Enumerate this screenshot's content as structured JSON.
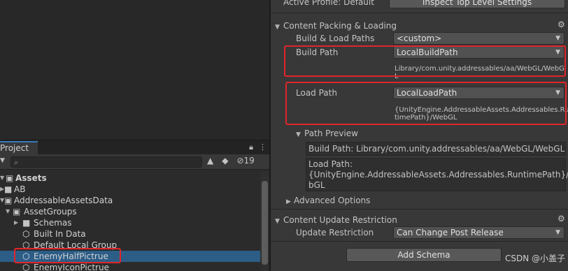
{
  "project": {
    "tab_label": "Project",
    "lock_icon": "lock-icon",
    "menu_icon": "kebab-menu-icon",
    "visible_count": "19",
    "tree": [
      {
        "label": "Assets",
        "icon": "folder-open-icon",
        "bold": true
      },
      {
        "label": "AB",
        "icon": "folder-icon"
      },
      {
        "label": "AddressableAssetsData",
        "icon": "folder-open-icon"
      },
      {
        "label": "AssetGroups",
        "icon": "folder-open-icon"
      },
      {
        "label": "Schemas",
        "icon": "folder-icon"
      },
      {
        "label": "Built In Data",
        "icon": "cube-icon"
      },
      {
        "label": "Default Local Group",
        "icon": "cube-icon"
      },
      {
        "label": "EnemyHalfPictrue",
        "icon": "cube-icon",
        "selected": true
      },
      {
        "label": "EnemyIconPictrue",
        "icon": "cube-icon"
      }
    ]
  },
  "inspector": {
    "active_profile_label": "Active Profile: Default",
    "inspect_button": "Inspect Top Level Settings",
    "content_packing_title": "Content Packing & Loading",
    "build_load_paths_label": "Build & Load Paths",
    "build_load_paths_value": "<custom>",
    "build_path_label": "Build Path",
    "build_path_value": "LocalBuildPath",
    "build_path_resolved_1": "Library/com.unity.addressables/aa/WebGL/WebG",
    "build_path_resolved_2": "L",
    "load_path_label": "Load Path",
    "load_path_value": "LocalLoadPath",
    "load_path_resolved_1": "{UnityEngine.AddressableAssets.Addressables.Run",
    "load_path_resolved_2": "timePath}/WebGL",
    "path_preview_title": "Path Preview",
    "preview_build_path": "Build Path: Library/com.unity.addressables/aa/WebGL/WebGL",
    "preview_load_path_1": "Load Path:",
    "preview_load_path_2": "{UnityEngine.AddressableAssets.Addressables.RuntimePath}/We",
    "preview_load_path_3": "bGL",
    "advanced_options_title": "Advanced Options",
    "content_update_title": "Content Update Restriction",
    "update_restriction_label": "Update Restriction",
    "update_restriction_value": "Can Change Post Release",
    "add_schema_button": "Add Schema"
  },
  "watermark": "CSDN @小盖子",
  "colors": {
    "selection": "#2c5d87",
    "highlight_box": "#e0262a",
    "tab_accent": "#3a79bb"
  }
}
